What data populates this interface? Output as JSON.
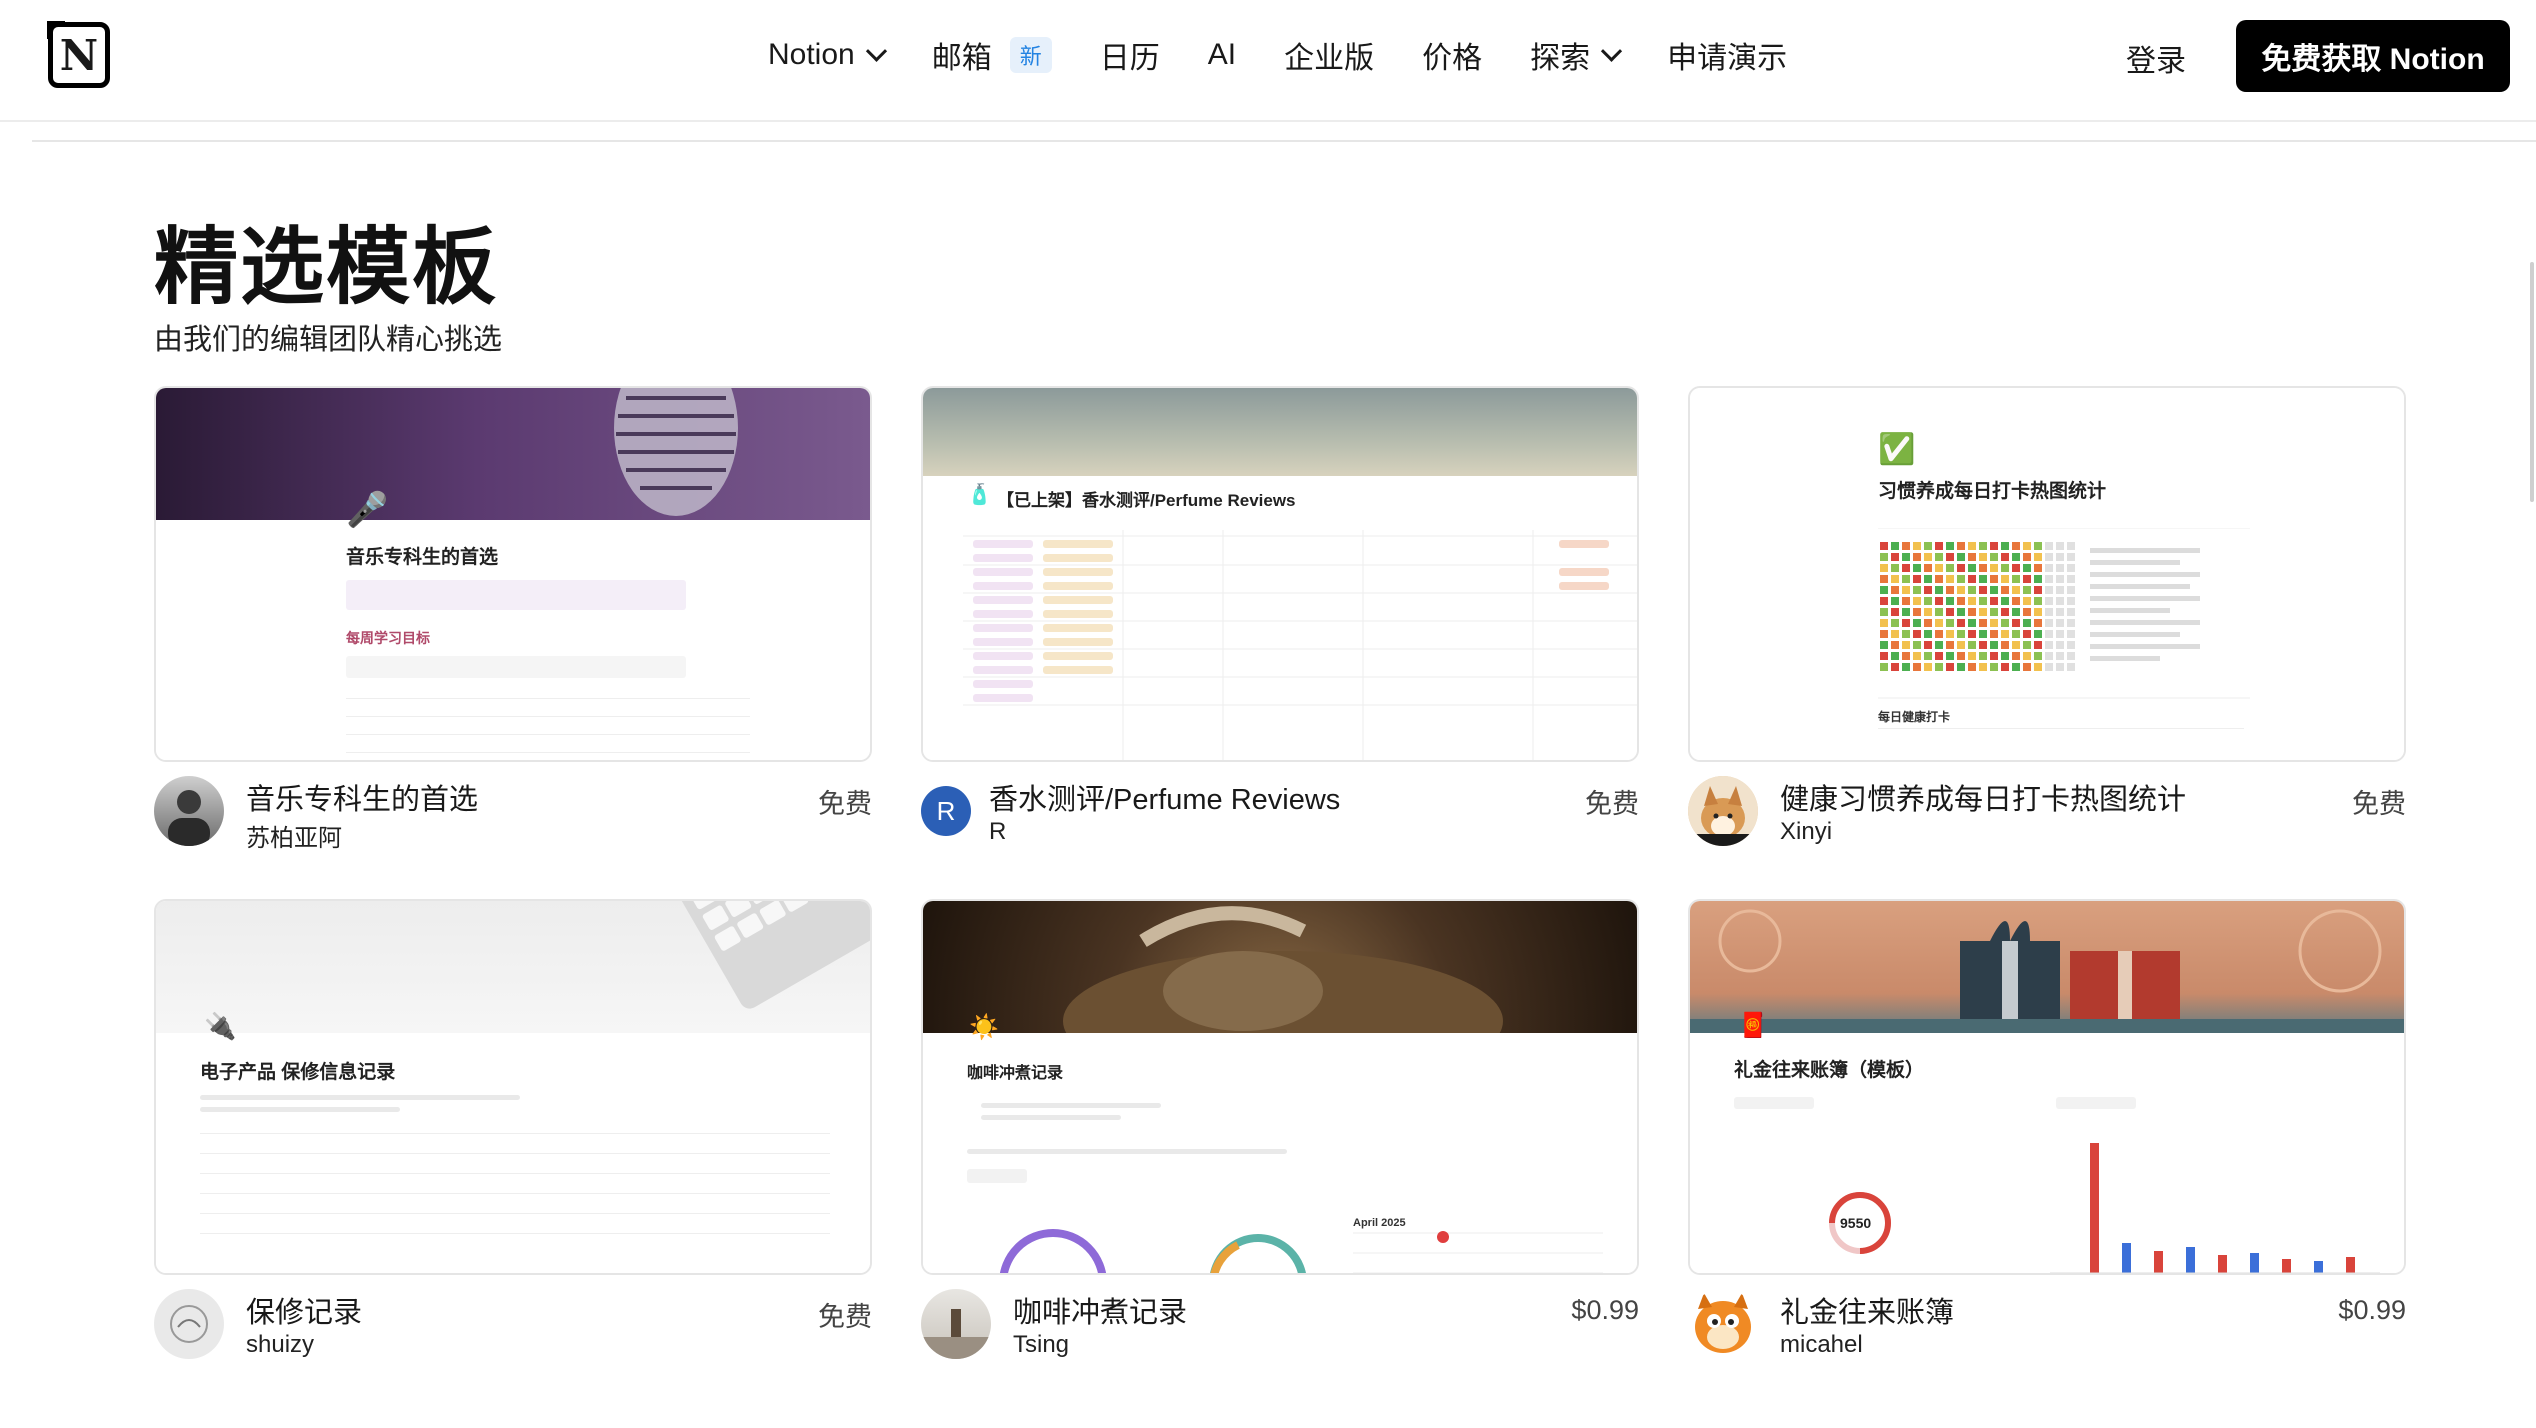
{
  "nav": {
    "logo": "N",
    "items": [
      {
        "label": "Notion",
        "has_dropdown": true
      },
      {
        "label": "邮箱",
        "badge": "新"
      },
      {
        "label": "日历"
      },
      {
        "label": "AI"
      },
      {
        "label": "企业版"
      },
      {
        "label": "价格"
      },
      {
        "label": "探索",
        "has_dropdown": true
      },
      {
        "label": "申请演示"
      }
    ],
    "login": "登录",
    "cta": "免费获取 Notion"
  },
  "section": {
    "title": "精选模板",
    "subtitle": "由我们的编辑团队精心挑选"
  },
  "templates": [
    {
      "title": "音乐专科生的首选",
      "author": "苏柏亚阿",
      "price": "免费",
      "preview_title": "音乐专科生的首选",
      "preview_icon": "microphone-icon",
      "preview_sub": "每周学习目标"
    },
    {
      "title": "香水测评/Perfume Reviews",
      "author": "R",
      "price": "免费",
      "avatar_letter": "R",
      "preview_title": "【已上架】香水测评/Perfume Reviews",
      "preview_icon": "perfume-icon"
    },
    {
      "title": "健康习惯养成每日打卡热图统计",
      "author": "Xinyi",
      "price": "免费",
      "preview_title": "习惯养成每日打卡热图统计",
      "preview_icon": "badge-check-icon",
      "preview_sub": "每日健康打卡"
    },
    {
      "title": "保修记录",
      "author": "shuizy",
      "price": "免费",
      "preview_title": "电子产品 保修信息记录",
      "preview_icon": "plug-icon"
    },
    {
      "title": "咖啡冲煮记录",
      "author": "Tsing",
      "price": "$0.99",
      "preview_title": "咖啡冲煮记录",
      "preview_icon": "sun-icon",
      "preview_sub": "April 2025"
    },
    {
      "title": "礼金往来账簿",
      "author": "micahel",
      "price": "$0.99",
      "preview_title": "礼金往来账簿（模板）",
      "preview_icon": "red-envelope-icon",
      "preview_value": "9550"
    }
  ],
  "colors": {
    "cta_bg": "#000000",
    "badge_bg": "#e6f0fb",
    "badge_text": "#2383e2",
    "avatar_r": "#2b5fb6"
  }
}
